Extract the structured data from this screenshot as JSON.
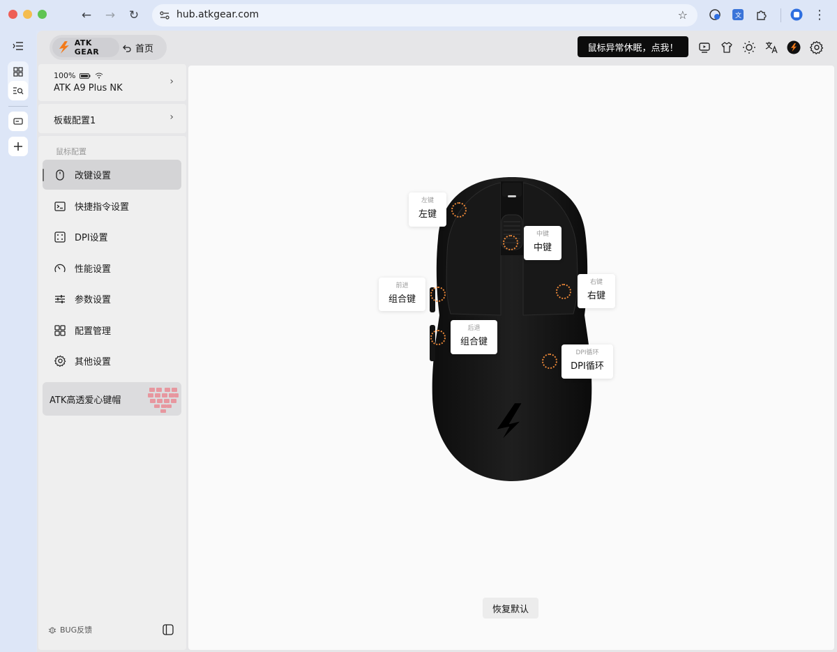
{
  "browser": {
    "url": "hub.atkgear.com"
  },
  "brand": {
    "name": "ATK GEAR",
    "home_label": "首页"
  },
  "header": {
    "sleep_button": "鼠标异常休眠，点我！"
  },
  "device": {
    "battery": "100%",
    "name": "ATK A9 Plus NK"
  },
  "profile": {
    "label": "板载配置1"
  },
  "sidebar": {
    "section_label": "鼠标配置",
    "items": [
      {
        "label": "改键设置",
        "icon": "mouse-icon",
        "active": true
      },
      {
        "label": "快捷指令设置",
        "icon": "terminal-icon"
      },
      {
        "label": "DPI设置",
        "icon": "dpi-icon"
      },
      {
        "label": "性能设置",
        "icon": "gauge-icon"
      },
      {
        "label": "参数设置",
        "icon": "sliders-icon"
      },
      {
        "label": "配置管理",
        "icon": "grid-icon"
      },
      {
        "label": "其他设置",
        "icon": "gear-icon"
      }
    ],
    "promo": "ATK高透爱心键帽",
    "bug_feedback": "BUG反馈"
  },
  "buttons": [
    {
      "sub": "左键",
      "label": "左键"
    },
    {
      "sub": "中键",
      "label": "中键"
    },
    {
      "sub": "前进",
      "label": "组合键"
    },
    {
      "sub": "右键",
      "label": "右键"
    },
    {
      "sub": "后退",
      "label": "组合键"
    },
    {
      "sub": "DPI循环",
      "label": "DPI循环"
    }
  ],
  "restore_default": "恢复默认",
  "colors": {
    "accent_orange": "#ef8a39",
    "brand_orange": "#f27a1a"
  }
}
